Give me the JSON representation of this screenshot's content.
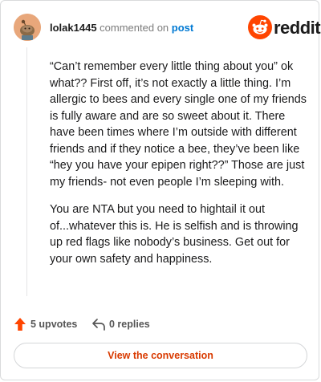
{
  "header": {
    "username": "lolak1445",
    "action_text": "commented on",
    "post_link_label": "post",
    "brand_name": "reddit",
    "brand_color": "#ff4500"
  },
  "comment": {
    "paragraphs": [
      "“Can’t remember every little thing about you” ok what?? First off, it’s not exactly a little thing. I’m allergic to bees and every single one of my friends is fully aware and are so sweet about it. There have been times where I’m outside with different friends and if they notice a bee, they’ve been like “hey you have your epipen right??” Those are just my friends- not even people I’m sleeping with.",
      "You are NTA but you need to hightail it out of...whatever this is. He is selfish and is throwing up red flags like nobody’s business. Get out for your own safety and happiness."
    ]
  },
  "actions": {
    "upvotes_label": "5 upvotes",
    "replies_label": "0 replies",
    "upvote_icon": "upvote-arrow-icon",
    "reply_icon": "reply-arrow-icon"
  },
  "cta": {
    "label": "View the conversation",
    "color": "#d93a00"
  }
}
